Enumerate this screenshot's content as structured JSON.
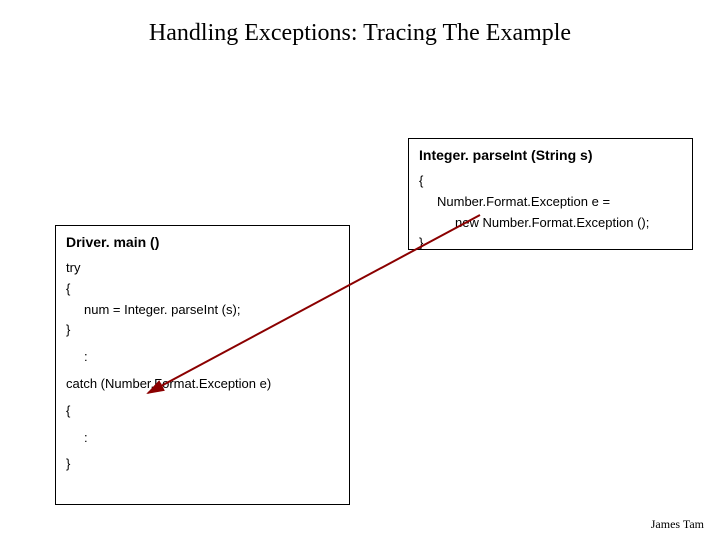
{
  "title": "Handling Exceptions: Tracing The Example",
  "driver": {
    "header": "Driver. main ()",
    "lines": {
      "try": "try",
      "open1": "{",
      "call": "num = Integer. parseInt (s);",
      "close1": "}",
      "colon1": ":",
      "catch": "catch (Number.Format.Exception e)",
      "open2": "{",
      "colon2": ":",
      "close2": "}"
    }
  },
  "integer": {
    "header": "Integer. parseInt (String s)",
    "lines": {
      "open": "{",
      "decl": "Number.Format.Exception e =",
      "new": "new Number.Format.Exception ();",
      "close": "}"
    }
  },
  "footer": "James Tam",
  "colors": {
    "arrow": "#8B0000"
  }
}
